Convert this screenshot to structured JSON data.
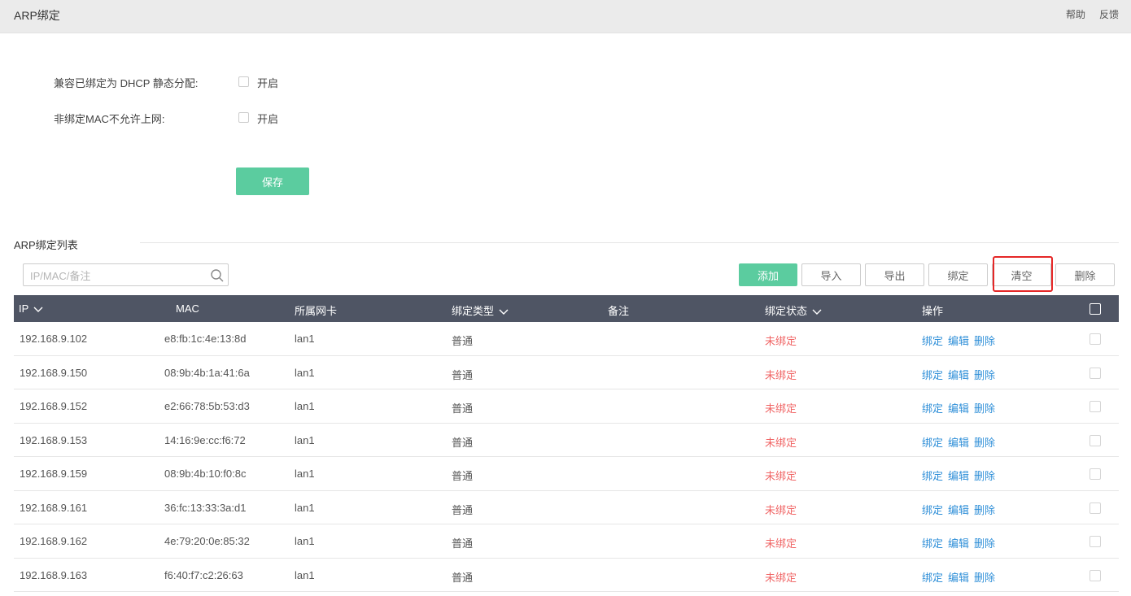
{
  "header": {
    "title": "ARP绑定",
    "help": "帮助",
    "feedback": "反馈"
  },
  "form": {
    "dhcp_compat_label": "兼容已绑定为 DHCP 静态分配:",
    "dhcp_compat_option": "开启",
    "block_unbound_label": "非绑定MAC不允许上网:",
    "block_unbound_option": "开启",
    "save": "保存"
  },
  "list": {
    "title": "ARP绑定列表",
    "search_placeholder": "IP/MAC/备注",
    "buttons": {
      "add": "添加",
      "import": "导入",
      "export": "导出",
      "bind": "绑定",
      "clear": "清空",
      "delete": "删除"
    },
    "columns": {
      "ip": "IP",
      "mac": "MAC",
      "iface": "所属网卡",
      "type": "绑定类型",
      "note": "备注",
      "status": "绑定状态",
      "actions": "操作"
    },
    "row_actions": {
      "bind": "绑定",
      "edit": "编辑",
      "delete": "删除"
    },
    "rows": [
      {
        "ip": "192.168.9.102",
        "mac": "e8:fb:1c:4e:13:8d",
        "iface": "lan1",
        "type": "普通",
        "note": "",
        "status": "未绑定"
      },
      {
        "ip": "192.168.9.150",
        "mac": "08:9b:4b:1a:41:6a",
        "iface": "lan1",
        "type": "普通",
        "note": "",
        "status": "未绑定"
      },
      {
        "ip": "192.168.9.152",
        "mac": "e2:66:78:5b:53:d3",
        "iface": "lan1",
        "type": "普通",
        "note": "",
        "status": "未绑定"
      },
      {
        "ip": "192.168.9.153",
        "mac": "14:16:9e:cc:f6:72",
        "iface": "lan1",
        "type": "普通",
        "note": "",
        "status": "未绑定"
      },
      {
        "ip": "192.168.9.159",
        "mac": "08:9b:4b:10:f0:8c",
        "iface": "lan1",
        "type": "普通",
        "note": "",
        "status": "未绑定"
      },
      {
        "ip": "192.168.9.161",
        "mac": "36:fc:13:33:3a:d1",
        "iface": "lan1",
        "type": "普通",
        "note": "",
        "status": "未绑定"
      },
      {
        "ip": "192.168.9.162",
        "mac": "4e:79:20:0e:85:32",
        "iface": "lan1",
        "type": "普通",
        "note": "",
        "status": "未绑定"
      },
      {
        "ip": "192.168.9.163",
        "mac": "f6:40:f7:c2:26:63",
        "iface": "lan1",
        "type": "普通",
        "note": "",
        "status": "未绑定"
      }
    ]
  },
  "colors": {
    "primary": "#5bcc9f",
    "header_bg": "#4f5564",
    "status_unbound": "#f06565",
    "link": "#2f8fd8",
    "highlight": "#e52727"
  }
}
